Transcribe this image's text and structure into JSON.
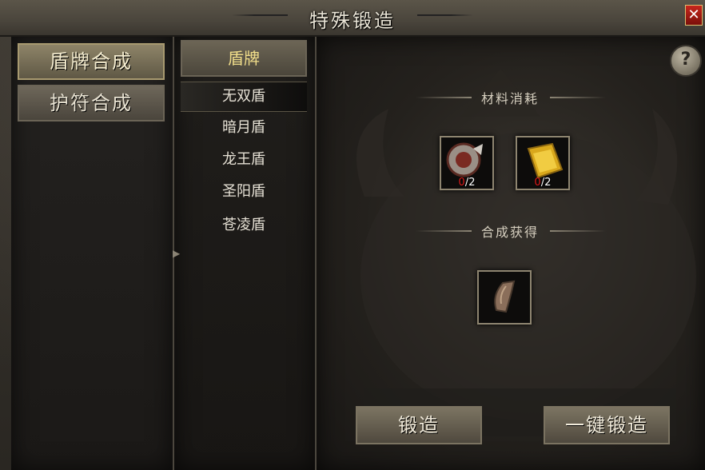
{
  "window": {
    "title": "特殊锻造",
    "close_label": "✕",
    "help_label": "?"
  },
  "left_tabs": [
    {
      "label": "盾牌合成",
      "active": true
    },
    {
      "label": "护符合成",
      "active": false
    }
  ],
  "category": {
    "header": "盾牌",
    "arrow": "»",
    "items": [
      {
        "label": "无双盾",
        "selected": true
      },
      {
        "label": "暗月盾",
        "selected": false
      },
      {
        "label": "龙王盾",
        "selected": false
      },
      {
        "label": "圣阳盾",
        "selected": false
      },
      {
        "label": "苍凌盾",
        "selected": false
      }
    ]
  },
  "materials": {
    "label": "材料消耗",
    "slots": [
      {
        "icon": "round-shield-icon",
        "have": "0",
        "need": "/2"
      },
      {
        "icon": "gold-ingot-icon",
        "have": "0",
        "need": "/2"
      }
    ]
  },
  "result": {
    "label": "合成获得",
    "icon": "rock-shield-icon"
  },
  "actions": {
    "forge": "锻造",
    "forge_all": "一键锻造"
  },
  "colors": {
    "accent_gold": "#f0dd8a",
    "count_red": "#e01a1a",
    "close_red": "#c8261c"
  }
}
